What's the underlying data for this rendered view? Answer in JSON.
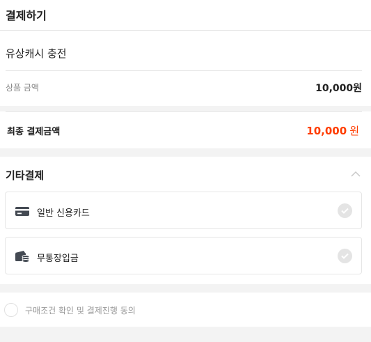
{
  "header": {
    "title": "결제하기"
  },
  "product": {
    "name": "유상캐시 충전",
    "amount_label": "상품 금액",
    "amount_value": "10,000원"
  },
  "final_amount": {
    "label": "최종 결제금액",
    "value": "10,000",
    "unit": "원",
    "color": "#ff3d00"
  },
  "payment": {
    "title": "기타결제",
    "collapse_icon": "chevron-up-icon",
    "options": [
      {
        "label": "일반 신용카드",
        "icon": "credit-card-icon",
        "selected": false
      },
      {
        "label": "무통장입금",
        "icon": "wallet-coins-icon",
        "selected": false
      }
    ]
  },
  "agreement": {
    "label": "구매조건 확인 및 결제진행 동의",
    "checked": false
  }
}
